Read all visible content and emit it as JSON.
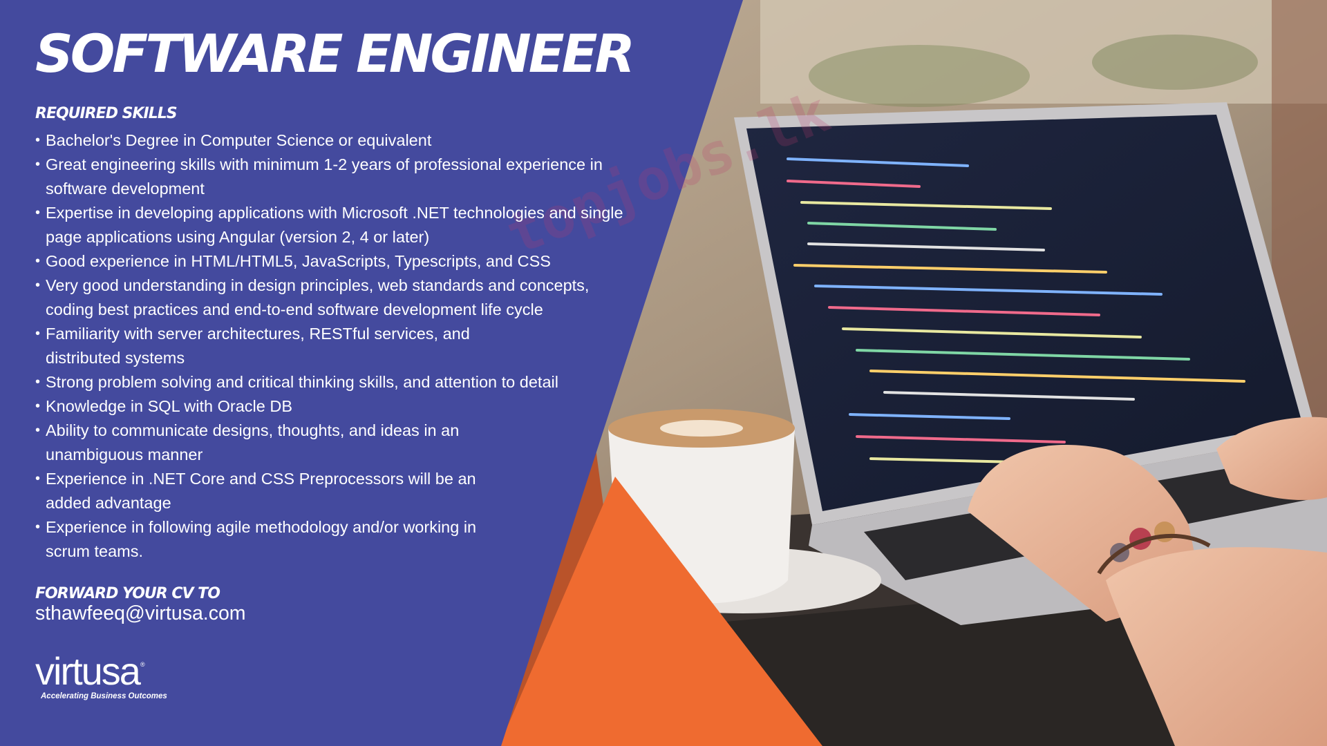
{
  "title": "SOFTWARE ENGINEER",
  "required_skills_heading": "REQUIRED SKILLS",
  "skills": [
    [
      "Bachelor's Degree in Computer Science or equivalent"
    ],
    [
      "Great engineering skills with minimum 1-2 years of professional experience in",
      "software development"
    ],
    [
      "Expertise in developing applications with Microsoft .NET technologies and single",
      "page applications using Angular (version 2, 4 or later)"
    ],
    [
      "Good experience in HTML/HTML5, JavaScripts, Typescripts, and CSS"
    ],
    [
      "Very good understanding in design principles, web standards and concepts,",
      "coding best practices and end-to-end software development life cycle"
    ],
    [
      "Familiarity with server architectures, RESTful services, and",
      "distributed systems"
    ],
    [
      "Strong problem solving and critical thinking skills, and attention to detail"
    ],
    [
      "Knowledge in SQL with Oracle DB"
    ],
    [
      "Ability to communicate designs, thoughts, and ideas in an",
      "unambiguous manner"
    ],
    [
      "Experience in .NET Core and CSS Preprocessors will be an",
      "added advantage"
    ],
    [
      "Experience in following agile methodology and/or working in",
      "scrum teams."
    ]
  ],
  "forward_heading": "FORWARD YOUR CV TO",
  "email": "sthawfeeq@virtusa.com",
  "logo": {
    "name": "virtusa",
    "registered": "®",
    "tagline": "Accelerating Business Outcomes"
  },
  "watermark": "topjobs.lk",
  "colors": {
    "panel": "#444a9e",
    "orange": "#ef6b30",
    "rust": "#b9532a",
    "text": "#ffffff"
  }
}
